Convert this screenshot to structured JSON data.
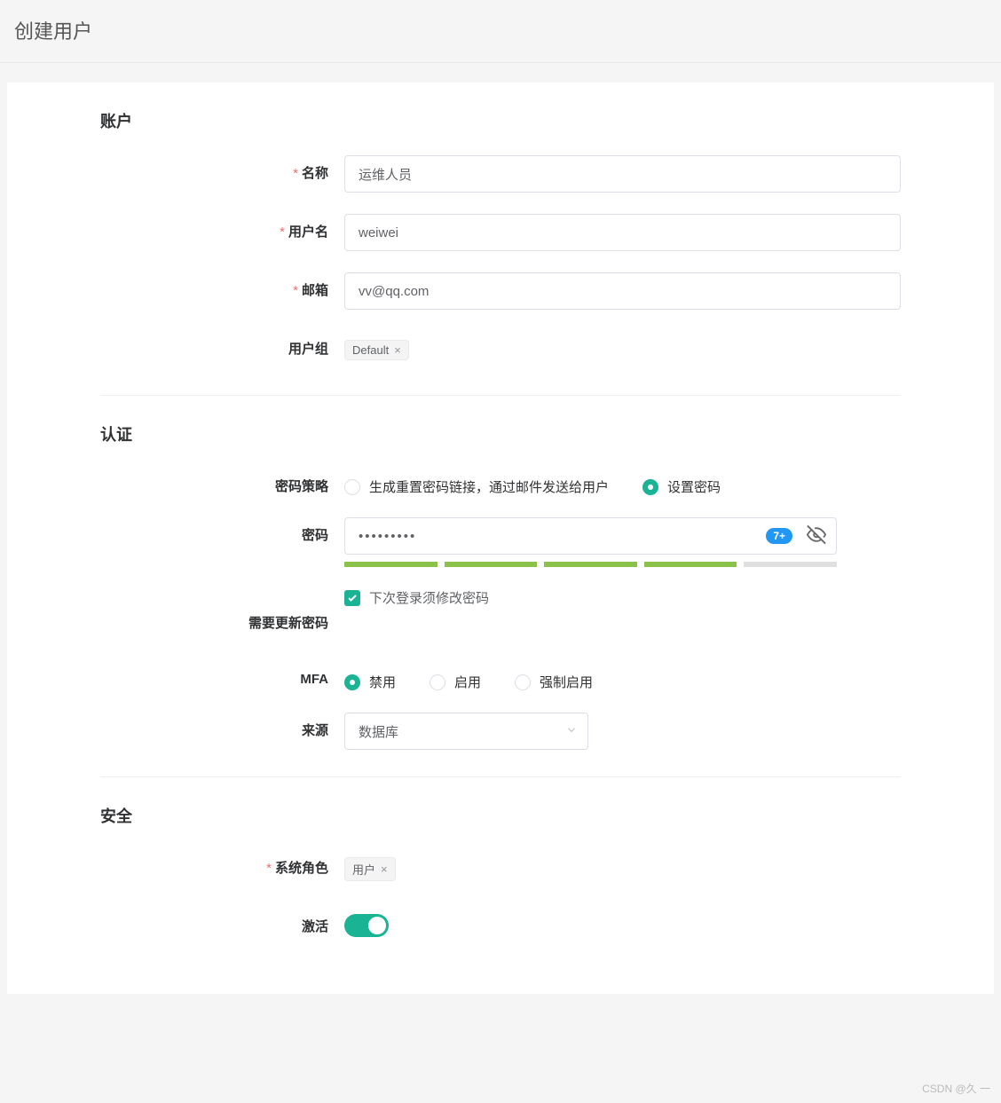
{
  "page_title": "创建用户",
  "sections": {
    "account": {
      "title": "账户",
      "fields": {
        "name": {
          "label": "名称",
          "value": "运维人员",
          "required": true
        },
        "username": {
          "label": "用户名",
          "value": "weiwei",
          "required": true
        },
        "email": {
          "label": "邮箱",
          "value": "vv@qq.com",
          "required": true
        },
        "user_group": {
          "label": "用户组",
          "tags": [
            "Default"
          ]
        }
      }
    },
    "auth": {
      "title": "认证",
      "fields": {
        "password_policy": {
          "label": "密码策略",
          "options": [
            {
              "label": "生成重置密码链接，通过邮件发送给用户",
              "checked": false
            },
            {
              "label": "设置密码",
              "checked": true
            }
          ]
        },
        "password": {
          "label": "密码",
          "value": "•••••••••",
          "badge": "7+",
          "strength_active": 4,
          "strength_total": 5
        },
        "need_update": {
          "label": "需要更新密码",
          "checkbox_label": "下次登录须修改密码",
          "checked": true
        },
        "mfa": {
          "label": "MFA",
          "options": [
            {
              "label": "禁用",
              "checked": true
            },
            {
              "label": "启用",
              "checked": false
            },
            {
              "label": "强制启用",
              "checked": false
            }
          ]
        },
        "source": {
          "label": "来源",
          "value": "数据库"
        }
      }
    },
    "security": {
      "title": "安全",
      "fields": {
        "system_role": {
          "label": "系统角色",
          "required": true,
          "tags": [
            "用户"
          ]
        },
        "active": {
          "label": "激活",
          "value": true
        }
      }
    }
  },
  "watermark": "CSDN @久 一"
}
